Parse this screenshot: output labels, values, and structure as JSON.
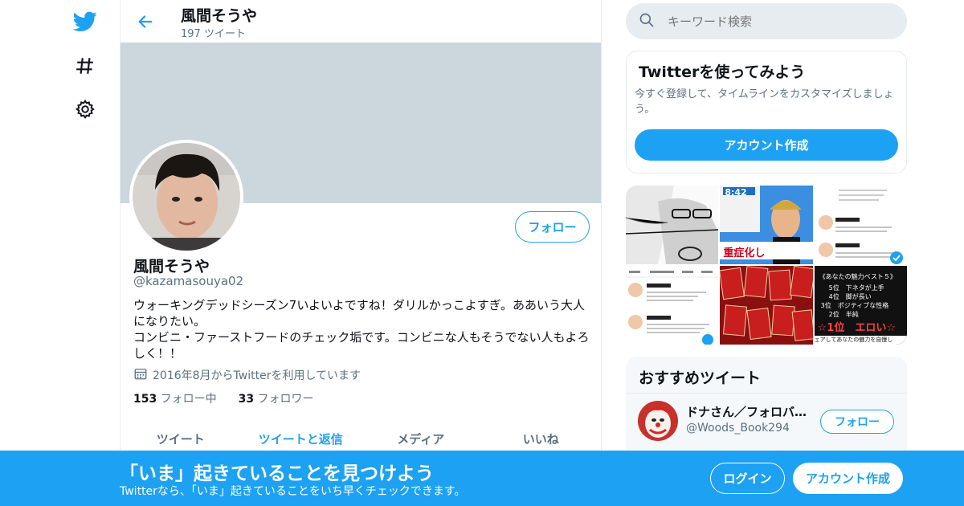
{
  "header": {
    "name": "風間そうや",
    "tweet_count": "197 ツイート"
  },
  "profile": {
    "name": "風間そうや",
    "handle": "@kazamasouya02",
    "bio": "ウォーキングデッドシーズン7いよいよですね！ダリルかっこよすぎ。ああいう大人になりたい。\nコンビニ・ファーストフードのチェック垢です。コンビニな人もそうでない人もよろしく！！",
    "joined": "2016年8月からTwitterを利用しています",
    "following_count": "153",
    "following_label": "フォロー中",
    "followers_count": "33",
    "followers_label": "フォロワー",
    "follow_label": "フォロー"
  },
  "tabs": [
    {
      "label": "ツイート"
    },
    {
      "label": "ツイートと返信"
    },
    {
      "label": "メディア"
    },
    {
      "label": "いいね"
    }
  ],
  "search": {
    "placeholder": "キーワード検索"
  },
  "signup_card": {
    "title": "Twitterを使ってみよう",
    "text": "今すぐ登録して、タイムラインをカスタマイズしましょう。",
    "button": "アカウント作成"
  },
  "media_tiles": {
    "tile2_time": "8:42",
    "tile2_caption": "重症化し",
    "tile6_title": "《あなたの魅力ベスト５》",
    "tile6_rank1": "5位　下ネタが上手",
    "tile6_rank2": "4位　脚が長い",
    "tile6_rank3": "3位　ポジティブな性格",
    "tile6_rank4": "2位　半純",
    "tile6_top": "☆1位　エロい☆",
    "tile6_footer": "ェアしてあなたの魅力を自慢し"
  },
  "recommended": {
    "title": "おすすめツイート",
    "items": [
      {
        "name": "ドナさん／フォロバ100…",
        "handle": "@Woods_Book294",
        "button": "フォロー"
      }
    ]
  },
  "bottom_bar": {
    "title": "「いま」起きていることを見つけよう",
    "subtitle": "Twitterなら、「いま」起きていることをいち早くチェックできます。",
    "login": "ログイン",
    "signup": "アカウント作成"
  },
  "colors": {
    "accent": "#1da1f2",
    "banner": "#ccd6dd",
    "muted": "#5b7083"
  }
}
